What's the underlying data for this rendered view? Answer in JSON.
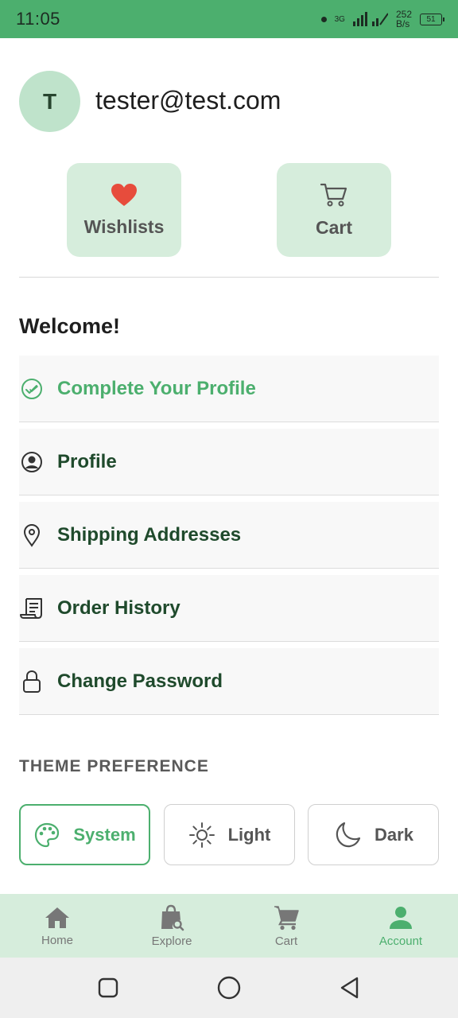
{
  "status_bar": {
    "time": "11:05",
    "network": "3G",
    "speed_value": "252",
    "speed_unit": "B/s",
    "battery": "51"
  },
  "header": {
    "avatar_initial": "T",
    "email": "tester@test.com"
  },
  "quick_actions": [
    {
      "label": "Wishlists",
      "icon": "heart-icon"
    },
    {
      "label": "Cart",
      "icon": "cart-icon"
    }
  ],
  "welcome_text": "Welcome!",
  "menu": [
    {
      "label": "Complete Your Profile",
      "icon": "check-circle-icon",
      "highlight": true
    },
    {
      "label": "Profile",
      "icon": "user-circle-icon"
    },
    {
      "label": "Shipping Addresses",
      "icon": "location-pin-icon"
    },
    {
      "label": "Order History",
      "icon": "receipt-icon"
    },
    {
      "label": "Change Password",
      "icon": "lock-icon"
    }
  ],
  "theme": {
    "heading": "THEME PREFERENCE",
    "options": [
      {
        "label": "System",
        "icon": "palette-icon",
        "selected": true
      },
      {
        "label": "Light",
        "icon": "sun-icon",
        "selected": false
      },
      {
        "label": "Dark",
        "icon": "moon-icon",
        "selected": false
      }
    ]
  },
  "bottom_nav": [
    {
      "label": "Home",
      "icon": "home-icon",
      "active": false
    },
    {
      "label": "Explore",
      "icon": "explore-bag-icon",
      "active": false
    },
    {
      "label": "Cart",
      "icon": "cart-icon",
      "active": false
    },
    {
      "label": "Account",
      "icon": "account-icon",
      "active": true
    }
  ],
  "colors": {
    "accent": "#4caf6e",
    "tile_background": "#d6eddc",
    "menu_text": "#1f4a2c",
    "heart": "#e74c3c"
  }
}
